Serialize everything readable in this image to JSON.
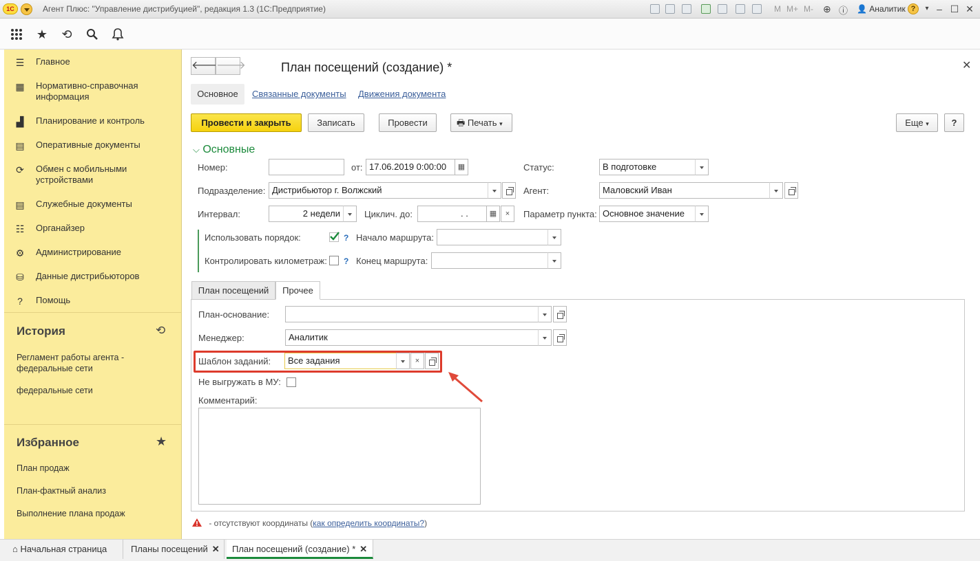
{
  "window": {
    "title": "Агент Плюс: \"Управление дистрибуцией\", редакция 1.3  (1С:Предприятие)",
    "logo_text": "1С",
    "toolbar_text": [
      "M",
      "M+",
      "M-"
    ],
    "user": "Аналитик"
  },
  "sidebar": {
    "items": [
      {
        "label": "Главное",
        "icon": "menu-lines-icon"
      },
      {
        "label": "Нормативно-справочная информация",
        "icon": "grid-icon"
      },
      {
        "label": "Планирование и контроль",
        "icon": "bar-chart-icon"
      },
      {
        "label": "Оперативные документы",
        "icon": "documents-icon"
      },
      {
        "label": "Обмен с мобильными устройствами",
        "icon": "sync-icon"
      },
      {
        "label": "Служебные документы",
        "icon": "documents-icon"
      },
      {
        "label": "Органайзер",
        "icon": "organizer-icon"
      },
      {
        "label": "Администрирование",
        "icon": "gear-icon"
      },
      {
        "label": "Данные дистрибьюторов",
        "icon": "database-icon"
      },
      {
        "label": "Помощь",
        "icon": "question-icon"
      }
    ],
    "history": {
      "title": "История",
      "items": [
        "Регламент работы агента - федеральные сети",
        "федеральные сети"
      ]
    },
    "favorites": {
      "title": "Избранное",
      "items": [
        "План продаж",
        "План-фактный анализ",
        "Выполнение плана продаж"
      ]
    }
  },
  "form": {
    "title": "План посещений  (создание) *",
    "tabs": [
      {
        "label": "Основное",
        "active": true
      },
      {
        "label": "Связанные документы",
        "active": false
      },
      {
        "label": "Движения документа",
        "active": false
      }
    ],
    "buttons": {
      "post_close": "Провести и закрыть",
      "save": "Записать",
      "post": "Провести",
      "print": "Печать",
      "more": "Еще",
      "help": "?"
    },
    "section_title": "Основные",
    "fields": {
      "number_label": "Номер:",
      "number_value": "",
      "date_label": "от:",
      "date_value": "17.06.2019  0:00:00",
      "status_label": "Статус:",
      "status_value": "В подготовке",
      "division_label": "Подразделение:",
      "division_value": "Дистрибьютор г. Волжский",
      "agent_label": "Агент:",
      "agent_value": "Маловский Иван",
      "interval_label": "Интервал:",
      "interval_value": "2 недели",
      "cycle_label": "Циклич. до:",
      "cycle_value": " .   .",
      "param_label": "Параметр пункта:",
      "param_value": "Основное значение",
      "use_order_label": "Использовать порядок:",
      "use_order_checked": true,
      "route_start_label": "Начало маршрута:",
      "route_start_value": "",
      "control_km_label": "Контролировать километраж:",
      "control_km_checked": false,
      "route_end_label": "Конец маршрута:",
      "route_end_value": ""
    },
    "inner_tabs": [
      {
        "label": "План посещений",
        "active": false
      },
      {
        "label": "Прочее",
        "active": true
      }
    ],
    "other": {
      "plan_basis_label": "План-основание:",
      "plan_basis_value": "",
      "manager_label": "Менеджер:",
      "manager_value": "Аналитик",
      "template_label": "Шаблон заданий:",
      "template_value": "Все задания",
      "no_export_label": "Не выгружать в МУ:",
      "no_export_checked": false,
      "comment_label": "Комментарий:",
      "comment_value": ""
    },
    "footnote": {
      "text": " - отсутствуют координаты (",
      "link": "как определить координаты?",
      "close": ")"
    }
  },
  "bottom_tabs": [
    {
      "label": "Начальная страница",
      "active": false
    },
    {
      "label": "Планы посещений",
      "active": false
    },
    {
      "label": "План посещений  (создание) *",
      "active": true
    }
  ],
  "colors": {
    "sidebar_bg": "#fbec9c",
    "primary_button": "#f6d20e",
    "accent_green": "#1b8a3b",
    "highlight_red": "#dd3b2c",
    "link_blue": "#3a5e9a"
  }
}
